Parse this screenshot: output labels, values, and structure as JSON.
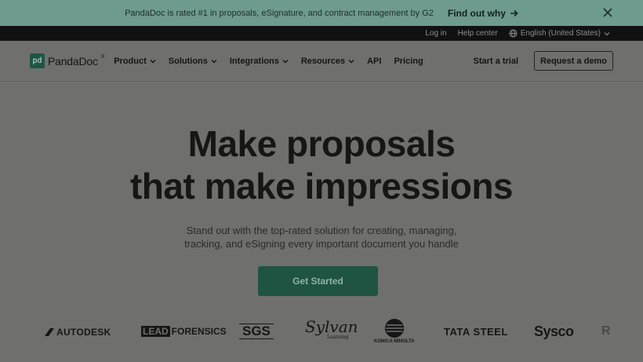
{
  "announcement": {
    "message": "PandaDoc is rated #1 in proposals, eSignature, and contract management by G2",
    "cta": "Find out why",
    "cta_icon": "arrow-right-icon",
    "close_icon": "close-icon"
  },
  "utility": {
    "login": "Log in",
    "help": "Help center",
    "language": "English (United States)",
    "language_icon": "globe-icon"
  },
  "nav": {
    "logo_mark": "pd",
    "logo_text": "PandaDoc",
    "logo_reg": "®",
    "menu": [
      {
        "label": "Product",
        "dropdown": true
      },
      {
        "label": "Solutions",
        "dropdown": true
      },
      {
        "label": "Integrations",
        "dropdown": true
      },
      {
        "label": "Resources",
        "dropdown": true
      },
      {
        "label": "API",
        "dropdown": false
      },
      {
        "label": "Pricing",
        "dropdown": false
      }
    ],
    "trial": "Start a trial",
    "demo": "Request a demo"
  },
  "hero": {
    "title_line1": "Make proposals",
    "title_line2": "that make impressions",
    "subtitle_line1": "Stand out with the top-rated solution for creating, managing,",
    "subtitle_line2": "tracking, and eSigning every important document you handle",
    "cta": "Get Started"
  },
  "brands": {
    "autodesk": "AUTODESK",
    "lead_box": "LEAD",
    "lead_rest": "FORENSICS",
    "sgs": "SGS",
    "sylvan": "Sylvan",
    "sylvan_sub": "Learning",
    "konica": "KONICA MINOLTA",
    "tata": "TATA STEEL",
    "sysco": "Sysco",
    "partial": "R"
  },
  "colors": {
    "announcement_bg": "#6e9a8f",
    "page_bg": "#6f706e",
    "utility_bg": "#111111",
    "primary_button": "#1f5342"
  }
}
